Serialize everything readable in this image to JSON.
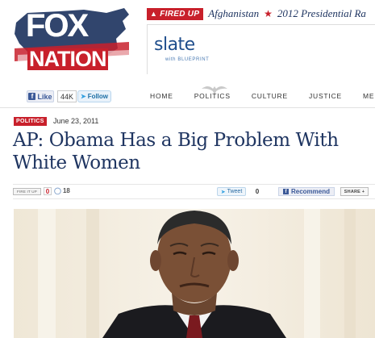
{
  "logo": {
    "line1": "FOX",
    "line2": "NATION"
  },
  "ticker": {
    "badge": "FIRED UP",
    "items": [
      "Afghanistan",
      "2012 Presidential Ra"
    ]
  },
  "ad": {
    "brand": "slate",
    "sub": "with BLUEPRINT"
  },
  "social": {
    "like_label": "Like",
    "like_count": "44K",
    "follow_label": "Follow"
  },
  "nav": {
    "items": [
      "HOME",
      "POLITICS",
      "CULTURE",
      "JUSTICE",
      "MEDIA"
    ]
  },
  "article": {
    "section": "POLITICS",
    "date": "June 23, 2011",
    "headline_line1": "AP: Obama Has a Big Problem With",
    "headline_line2": "White Women"
  },
  "share": {
    "fireit_label": "FIRE IT UP",
    "fire_count": "0",
    "comment_count": "18",
    "tweet_label": "Tweet",
    "tweet_count": "0",
    "recommend_label": "Recommend",
    "sharethis_label": "SHARE +"
  },
  "colors": {
    "brand_navy": "#1f3561",
    "brand_red": "#c8202b",
    "facebook_blue": "#3b5998",
    "twitter_blue": "#33a0e0"
  }
}
